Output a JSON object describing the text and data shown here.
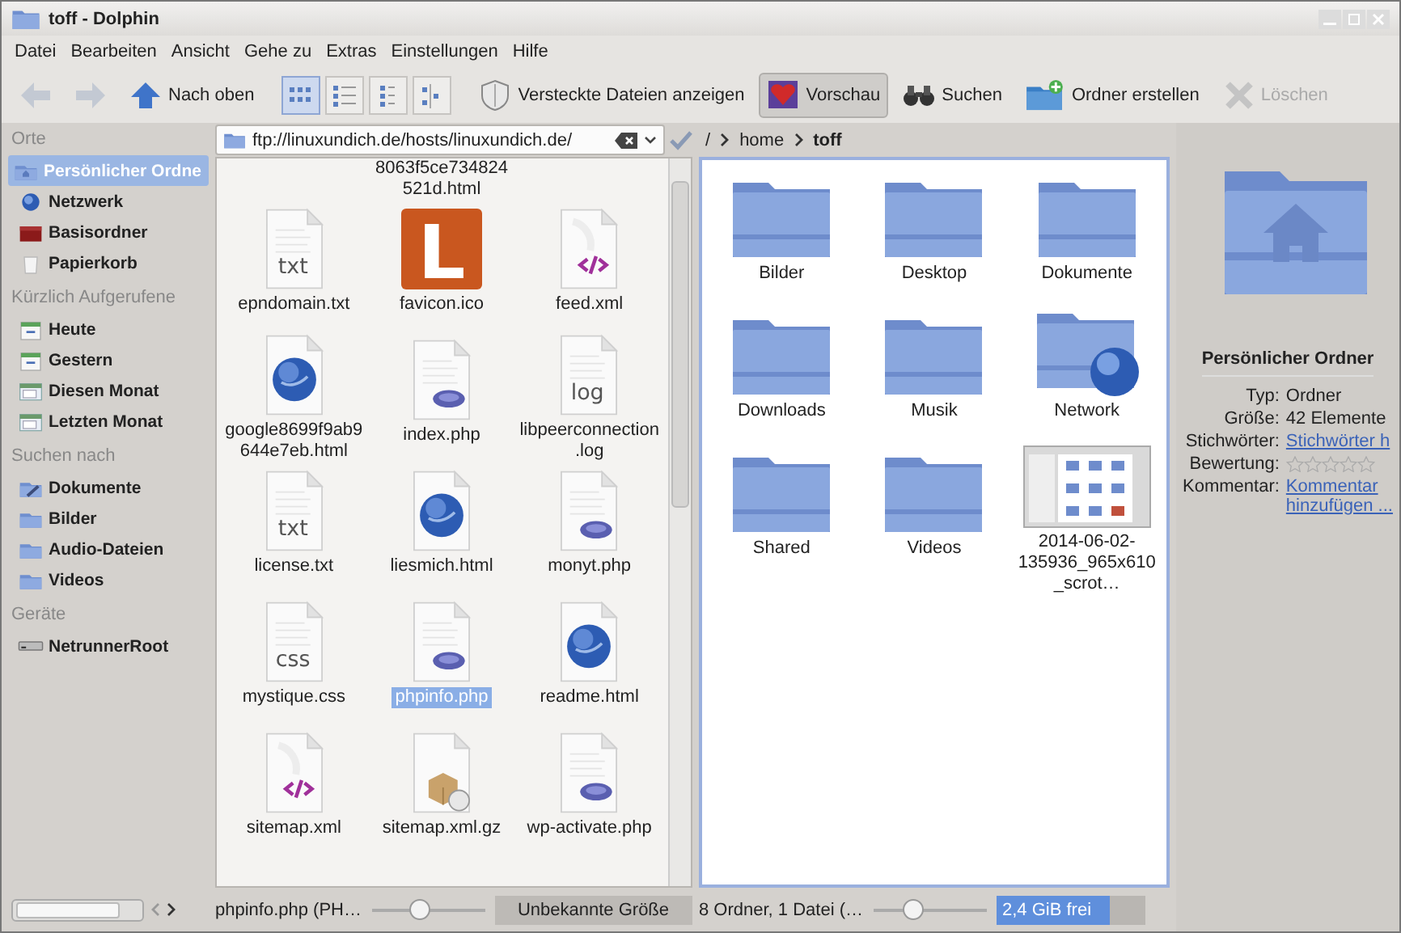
{
  "window": {
    "title": "toff - Dolphin"
  },
  "menu": [
    "Datei",
    "Bearbeiten",
    "Ansicht",
    "Gehe zu",
    "Extras",
    "Einstellungen",
    "Hilfe"
  ],
  "toolbar": {
    "back": {
      "disabled": true
    },
    "forward": {
      "disabled": true
    },
    "up": {
      "label": "Nach oben",
      "disabled": false
    },
    "view_modes": [
      {
        "kind": "icons",
        "selected": true
      },
      {
        "kind": "details",
        "selected": false
      },
      {
        "kind": "compact",
        "selected": false
      },
      {
        "kind": "columns",
        "selected": false
      }
    ],
    "actions": [
      {
        "kind": "hidden",
        "label": "Versteckte Dateien anzeigen",
        "checked": false,
        "disabled": false
      },
      {
        "kind": "preview",
        "label": "Vorschau",
        "checked": true,
        "disabled": false
      },
      {
        "kind": "search",
        "label": "Suchen",
        "checked": false,
        "disabled": false
      },
      {
        "kind": "new-folder",
        "label": "Ordner erstellen",
        "checked": false,
        "disabled": false
      },
      {
        "kind": "delete",
        "label": "Löschen",
        "checked": false,
        "disabled": true
      }
    ]
  },
  "sidebar": {
    "sections": [
      {
        "title": "Orte",
        "items": [
          {
            "label": "Persönlicher Ordne",
            "kind": "home",
            "selected": true
          },
          {
            "label": "Netzwerk",
            "kind": "network",
            "selected": false
          },
          {
            "label": "Basisordner",
            "kind": "root",
            "selected": false
          },
          {
            "label": "Papierkorb",
            "kind": "trash",
            "selected": false
          }
        ]
      },
      {
        "title": "Kürzlich Aufgerufene",
        "items": [
          {
            "label": "Heute",
            "kind": "calendar",
            "selected": false
          },
          {
            "label": "Gestern",
            "kind": "calendar",
            "selected": false
          },
          {
            "label": "Diesen Monat",
            "kind": "month",
            "selected": false
          },
          {
            "label": "Letzten Monat",
            "kind": "month",
            "selected": false
          }
        ]
      },
      {
        "title": "Suchen nach",
        "items": [
          {
            "label": "Dokumente",
            "kind": "documents",
            "selected": false
          },
          {
            "label": "Bilder",
            "kind": "folder",
            "selected": false
          },
          {
            "label": "Audio-Dateien",
            "kind": "folder",
            "selected": false
          },
          {
            "label": "Videos",
            "kind": "folder",
            "selected": false
          }
        ]
      },
      {
        "title": "Geräte",
        "items": [
          {
            "label": "NetrunnerRoot",
            "kind": "drive",
            "selected": false
          }
        ]
      }
    ]
  },
  "left_pane": {
    "active": false,
    "location": "ftp://linuxundich.de/hosts/linuxundich.de/",
    "items": [
      {
        "name": "8063f5ce734824521d.html",
        "kind": "label-only",
        "selected": false
      },
      {
        "name": "epndomain.txt",
        "kind": "text",
        "icon_text": "txt",
        "selected": false
      },
      {
        "name": "favicon.ico",
        "kind": "favicon",
        "icon_text": "L",
        "selected": false
      },
      {
        "name": "feed.xml",
        "kind": "xml",
        "selected": false
      },
      {
        "name": "google8699f9ab9644e7eb.html",
        "kind": "html",
        "selected": false
      },
      {
        "name": "index.php",
        "kind": "php",
        "selected": false
      },
      {
        "name": "libpeerconnection.log",
        "kind": "text",
        "icon_text": "log",
        "selected": false
      },
      {
        "name": "license.txt",
        "kind": "text",
        "icon_text": "txt",
        "selected": false
      },
      {
        "name": "liesmich.html",
        "kind": "html",
        "selected": false
      },
      {
        "name": "monyt.php",
        "kind": "php",
        "selected": false
      },
      {
        "name": "mystique.css",
        "kind": "text",
        "icon_text": "css",
        "selected": false
      },
      {
        "name": "phpinfo.php",
        "kind": "php",
        "selected": true
      },
      {
        "name": "readme.html",
        "kind": "html",
        "selected": false
      },
      {
        "name": "sitemap.xml",
        "kind": "xml",
        "selected": false
      },
      {
        "name": "sitemap.xml.gz",
        "kind": "archive",
        "selected": false
      },
      {
        "name": "wp-activate.php",
        "kind": "php",
        "selected": false
      }
    ],
    "status": {
      "text": "phpinfo.php (PH…",
      "zoom": {
        "level": 0.42
      },
      "size": "Unbekannte Größe"
    }
  },
  "right_pane": {
    "active": true,
    "breadcrumb": [
      {
        "label": "/",
        "selected": false
      },
      {
        "label": "home",
        "selected": false
      },
      {
        "label": "toff",
        "selected": true
      }
    ],
    "items": [
      {
        "name": "Bilder",
        "kind": "folder",
        "selected": false
      },
      {
        "name": "Desktop",
        "kind": "folder",
        "selected": false
      },
      {
        "name": "Dokumente",
        "kind": "folder",
        "selected": false
      },
      {
        "name": "Downloads",
        "kind": "folder",
        "selected": false
      },
      {
        "name": "Musik",
        "kind": "folder",
        "selected": false
      },
      {
        "name": "Network",
        "kind": "network-folder",
        "selected": false
      },
      {
        "name": "Shared",
        "kind": "folder",
        "selected": false
      },
      {
        "name": "Videos",
        "kind": "folder",
        "selected": false
      },
      {
        "name": "2014-06-02-135936_965x610_scrot…",
        "kind": "screenshot",
        "selected": false
      }
    ],
    "status": {
      "text": "8 Ordner, 1 Datei (…",
      "zoom": {
        "level": 0.33
      },
      "free": {
        "label": "2,4 GiB frei",
        "level": 0.77
      }
    }
  },
  "info": {
    "title": "Persönlicher Ordner",
    "fields": [
      {
        "label": "Typ:",
        "kind": "text",
        "value": "Ordner"
      },
      {
        "label": "Größe:",
        "kind": "text",
        "value": "42 Elemente"
      },
      {
        "label": "Stichwörter:",
        "kind": "link",
        "value": "Stichwörter h"
      },
      {
        "label": "Bewertung:",
        "kind": "rating",
        "stars": 0
      },
      {
        "label": "Kommentar:",
        "kind": "link",
        "value": "Kommentar hinzufügen ..."
      }
    ]
  }
}
